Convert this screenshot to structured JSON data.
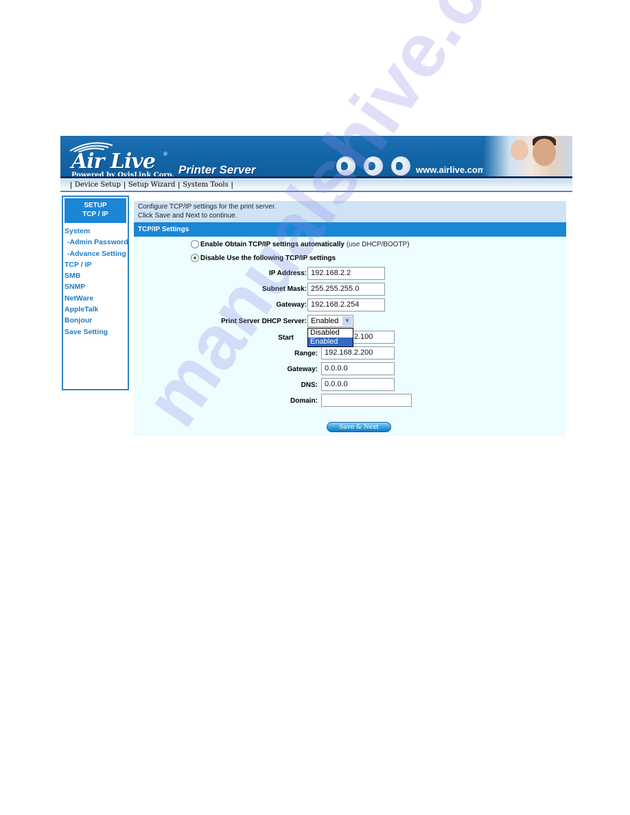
{
  "banner": {
    "brand": "Air Live",
    "registered_mark": "®",
    "tagline": "Powered by OvisLink Corp.",
    "product": "Printer Server",
    "website": "www.airlive.com"
  },
  "nav": {
    "items": [
      {
        "label": "Device Setup"
      },
      {
        "label": "Setup Wizard"
      },
      {
        "label": "System Tools"
      }
    ]
  },
  "sidebar": {
    "header_line1": "SETUP",
    "header_line2": "TCP / IP",
    "items": [
      {
        "label": "System"
      },
      {
        "label": "-Admin Password"
      },
      {
        "label": "-Advance Setting"
      },
      {
        "label": "TCP / IP"
      },
      {
        "label": "SMB"
      },
      {
        "label": "SNMP"
      },
      {
        "label": "NetWare"
      },
      {
        "label": "AppleTalk"
      },
      {
        "label": "Bonjour"
      },
      {
        "label": "Save Setting"
      }
    ]
  },
  "main": {
    "intro_line1": "Configure TCP/IP settings for the print server.",
    "intro_line2": "Click Save and Next to continue.",
    "section_title": "TCP/IP Settings",
    "radio_auto": {
      "label": "Enable Obtain TCP/IP settings automatically",
      "note": "(use DHCP/BOOTP)",
      "selected": false
    },
    "radio_manual": {
      "label": "Disable Use the following TCP/IP settings",
      "selected": true
    },
    "fields": {
      "ip_address": {
        "label": "IP Address:",
        "value": "192.168.2.2"
      },
      "subnet_mask": {
        "label": "Subnet Mask:",
        "value": "255.255.255.0"
      },
      "gateway": {
        "label": "Gateway:",
        "value": "192.168.2.254"
      }
    },
    "dhcp": {
      "label": "Print Server DHCP Server:",
      "selected": "Enabled",
      "options": [
        "Disabled",
        "Enabled"
      ],
      "highlighted": "Enabled",
      "start": {
        "label": "Start",
        "value": "192.168.2.100"
      },
      "range": {
        "label": "Range:",
        "value": "192.168.2.200"
      },
      "gateway": {
        "label": "Gateway:",
        "value": "0.0.0.0"
      },
      "dns": {
        "label": "DNS:",
        "value": "0.0.0.0"
      },
      "domain": {
        "label": "Domain:",
        "value": ""
      }
    },
    "save_label": "Save & Next"
  },
  "watermark": "manualshive.com",
  "colors": {
    "accent": "#1a86d6",
    "sidebar_text": "#1a7cc8",
    "panel_bg": "#eefdff",
    "intro_bg": "#cfe3f5",
    "selection": "#316ac5"
  }
}
